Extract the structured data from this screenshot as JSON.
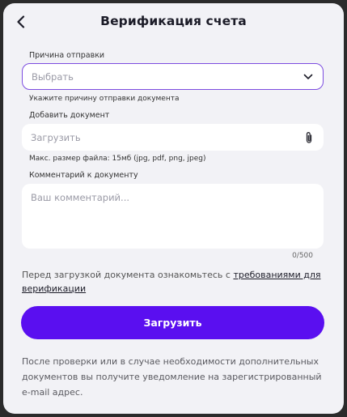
{
  "header": {
    "title": "Верификация счета",
    "back_icon": "chevron-left-icon"
  },
  "reason": {
    "label": "Причина отправки",
    "placeholder": "Выбрать",
    "hint": "Укажите причину отправки документа",
    "icon": "chevron-down-icon",
    "border_color": "#7c4ce0"
  },
  "document": {
    "label": "Добавить документ",
    "placeholder": "Загрузить",
    "hint": "Макс. размер файла: 15мб (jpg, pdf, png, jpeg)",
    "icon": "paperclip-icon"
  },
  "comment": {
    "label": "Комментарий к документу",
    "placeholder": "Ваш комментарий...",
    "counter": "0/500"
  },
  "notice": {
    "text": "Перед загрузкой документа ознакомьтесь с ",
    "link": "требованиями для верификации"
  },
  "submit": {
    "label": "Загрузить",
    "color": "#5a0ff0"
  },
  "footer": {
    "text": "После проверки или в случае необходимости дополнительных документов вы получите уведомление на зарегистрированный e-mail адрес."
  }
}
